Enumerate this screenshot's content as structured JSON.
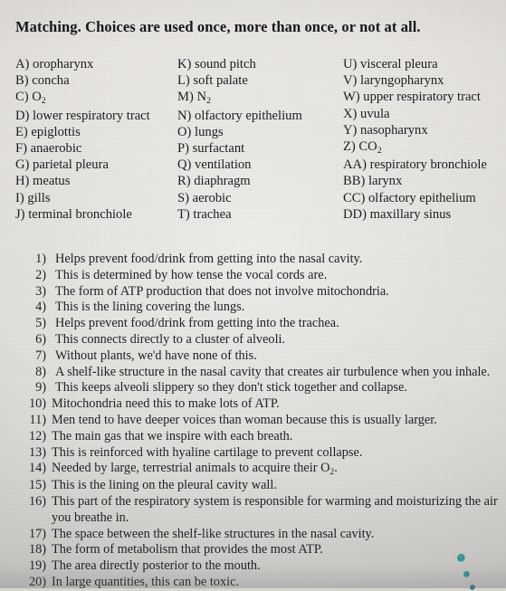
{
  "document": {
    "title": "Matching. Choices are used once, more than once, or not at all.",
    "paper_color": "#dcd9d3",
    "ink_color": "#1b1b22",
    "mark_color": "#2f8e92"
  },
  "choices": {
    "column_1": [
      {
        "label": "A)",
        "text": "oropharynx"
      },
      {
        "label": "B)",
        "text": "concha"
      },
      {
        "label": "C)",
        "text": "O2",
        "formatted": "O<sub>2</sub>"
      },
      {
        "label": "D)",
        "text": "lower respiratory tract"
      },
      {
        "label": "E)",
        "text": "epiglottis"
      },
      {
        "label": "F)",
        "text": "anaerobic"
      },
      {
        "label": "G)",
        "text": "parietal pleura"
      },
      {
        "label": "H)",
        "text": "meatus"
      },
      {
        "label": "I)",
        "text": "gills"
      },
      {
        "label": "J)",
        "text": "terminal bronchiole"
      }
    ],
    "column_2": [
      {
        "label": "K)",
        "text": "sound pitch"
      },
      {
        "label": "L)",
        "text": "soft palate"
      },
      {
        "label": "M)",
        "text": "N2",
        "formatted": "N<sub>2</sub>"
      },
      {
        "label": "N)",
        "text": "olfactory epithelium"
      },
      {
        "label": "O)",
        "text": "lungs"
      },
      {
        "label": "P)",
        "text": "surfactant"
      },
      {
        "label": "Q)",
        "text": "ventilation"
      },
      {
        "label": "R)",
        "text": "diaphragm"
      },
      {
        "label": "S)",
        "text": "aerobic"
      },
      {
        "label": "T)",
        "text": "trachea"
      }
    ],
    "column_3": [
      {
        "label": "U)",
        "text": "visceral pleura"
      },
      {
        "label": "V)",
        "text": "laryngopharynx"
      },
      {
        "label": "W)",
        "text": "upper respiratory tract"
      },
      {
        "label": "X)",
        "text": "uvula"
      },
      {
        "label": "Y)",
        "text": "nasopharynx"
      },
      {
        "label": "Z)",
        "text": "CO2",
        "formatted": "CO<sub>2</sub>"
      },
      {
        "label": "AA)",
        "text": "respiratory bronchiole"
      },
      {
        "label": "BB)",
        "text": "larynx"
      },
      {
        "label": "CC)",
        "text": "olfactory epithelium"
      },
      {
        "label": "DD)",
        "text": "maxillary sinus"
      }
    ]
  },
  "questions": [
    {
      "number": "1)",
      "text": "Helps prevent food/drink from getting into the nasal cavity."
    },
    {
      "number": "2)",
      "text": "This is determined by how tense the vocal cords are."
    },
    {
      "number": "3)",
      "text": "The form of ATP production that does not involve mitochondria."
    },
    {
      "number": "4)",
      "text": "This is the lining covering the lungs."
    },
    {
      "number": "5)",
      "text": "Helps prevent food/drink from getting into the trachea."
    },
    {
      "number": "6)",
      "text": "This connects directly to a cluster of alveoli."
    },
    {
      "number": "7)",
      "text": "Without plants, we'd have none of this."
    },
    {
      "number": "8)",
      "text": "A shelf-like structure in the nasal cavity that creates air turbulence when you inhale."
    },
    {
      "number": "9)",
      "text": "This keeps alveoli slippery so they don't stick together and collapse."
    },
    {
      "number": "10)",
      "text": "Mitochondria need this to make lots of ATP."
    },
    {
      "number": "11)",
      "text": "Men tend to have deeper voices than woman because this is usually larger."
    },
    {
      "number": "12)",
      "text": "The main gas that we inspire with each breath."
    },
    {
      "number": "13)",
      "text": "This is reinforced with hyaline cartilage to prevent collapse."
    },
    {
      "number": "14)",
      "text": "Needed by large, terrestrial animals to acquire their O2.",
      "formatted": "Needed by large, terrestrial animals to acquire their O<sub>2</sub>."
    },
    {
      "number": "15)",
      "text": "This is the lining on the pleural cavity wall."
    },
    {
      "number": "16)",
      "text": "This part of the respiratory system is responsible for warming and moisturizing the air you breathe in."
    },
    {
      "number": "17)",
      "text": "The space between the shelf-like structures in the nasal cavity."
    },
    {
      "number": "18)",
      "text": "The form of metabolism that provides the most ATP."
    },
    {
      "number": "19)",
      "text": "The area directly posterior to the mouth."
    },
    {
      "number": "20)",
      "text": "In large quantities, this can be toxic."
    }
  ],
  "marks": {
    "dots": [
      {
        "name": "teal-dot-large"
      },
      {
        "name": "teal-dot-medium"
      },
      {
        "name": "teal-dot-small"
      }
    ]
  }
}
